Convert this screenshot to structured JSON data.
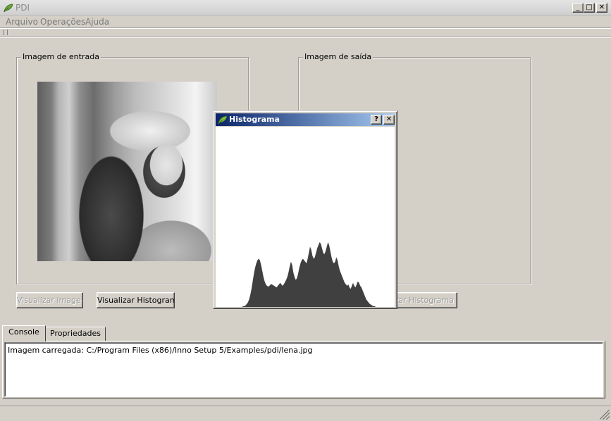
{
  "window": {
    "title": "PDI",
    "minimize_label": "_",
    "maximize_label": "□",
    "close_label": "✕"
  },
  "menu": {
    "items": [
      "Arquivo",
      "Operações",
      "Ajuda"
    ]
  },
  "input_panel": {
    "group_label": "Imagem de entrada",
    "view_image_button": "Visualizar imagem",
    "view_histogram_button": "Visualizar Histograma"
  },
  "output_panel": {
    "group_label": "Imagem de saída",
    "view_histogram_button_visible_part": "alizar Histograma"
  },
  "tabs": [
    "Console",
    "Propriedades"
  ],
  "console": {
    "log_line": "Imagem carregada: C:/Program Files (x86)/Inno Setup 5/Examples/pdi/lena.jpg"
  },
  "histogram_dialog": {
    "title": "Histograma",
    "help_label": "?",
    "close_label": "✕",
    "bar_color": "#404040",
    "levels": [
      0,
      0,
      0,
      0,
      0,
      0,
      0,
      0,
      0,
      0,
      0,
      0,
      0,
      0,
      0,
      0,
      0,
      0,
      0,
      0,
      0,
      0,
      0,
      1,
      1,
      2,
      4,
      6,
      10,
      16,
      24,
      34,
      44,
      52,
      58,
      62,
      64,
      62,
      56,
      48,
      40,
      34,
      30,
      28,
      27,
      28,
      30,
      30,
      29,
      28,
      27,
      26,
      28,
      30,
      32,
      30,
      28,
      30,
      33,
      36,
      40,
      46,
      54,
      60,
      56,
      46,
      40,
      36,
      38,
      44,
      52,
      58,
      62,
      64,
      62,
      60,
      58,
      64,
      72,
      80,
      76,
      68,
      64,
      66,
      72,
      78,
      82,
      86,
      84,
      78,
      72,
      70,
      74,
      80,
      86,
      82,
      74,
      66,
      60,
      58,
      60,
      66,
      62,
      54,
      48,
      44,
      40,
      36,
      32,
      30,
      28,
      30,
      26,
      24,
      28,
      32,
      28,
      26,
      30,
      34,
      32,
      28,
      26,
      22,
      18,
      14,
      10,
      8,
      6,
      4,
      3,
      2,
      1,
      1,
      0,
      0,
      0,
      0,
      0
    ]
  }
}
